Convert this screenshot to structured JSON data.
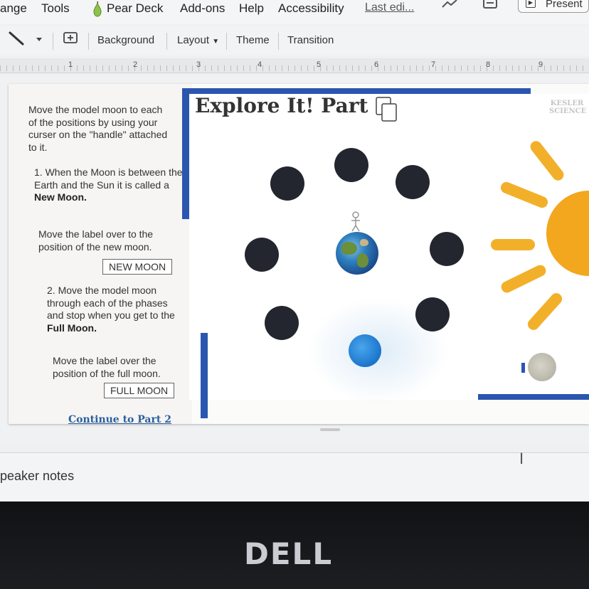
{
  "menubar": {
    "items": [
      "ange",
      "Tools",
      "Pear Deck",
      "Add-ons",
      "Help",
      "Accessibility"
    ],
    "last_edit": "Last edi...",
    "present_label": "Present"
  },
  "toolbar": {
    "background_label": "Background",
    "layout_label": "Layout",
    "theme_label": "Theme",
    "transition_label": "Transition"
  },
  "ruler": {
    "numbers": [
      "1",
      "2",
      "3",
      "4",
      "5",
      "6",
      "7",
      "8",
      "9"
    ]
  },
  "slide": {
    "title": "Explore It! Part 1",
    "logo_line1": "KESLER",
    "logo_line2": "SCIENCE",
    "instructions": {
      "intro": "Move the model moon to each of the positions by using your curser on the \"handle\" attached to it.",
      "step1_prefix": "1. When the Moon is between the Earth and the Sun it is called a ",
      "step1_bold": "New Moon.",
      "move_label_new": "Move the label over to the position of the new moon.",
      "new_moon_label": "NEW MOON",
      "step2_prefix": "2. Move the model moon through each of the phases and stop when you get to the ",
      "step2_bold": "Full Moon.",
      "move_label_full": "Move the label over the position of the full moon.",
      "full_moon_label": "FULL MOON",
      "continue_link": "Continue to Part 2"
    }
  },
  "speaker_notes": {
    "label": "peaker notes"
  },
  "brand": {
    "logo": "DELL"
  },
  "colors": {
    "frame_blue": "#2a56b0",
    "moon_dark": "#23262e",
    "sun_orange": "#f2a71e",
    "link_blue": "#2b5f9e"
  }
}
